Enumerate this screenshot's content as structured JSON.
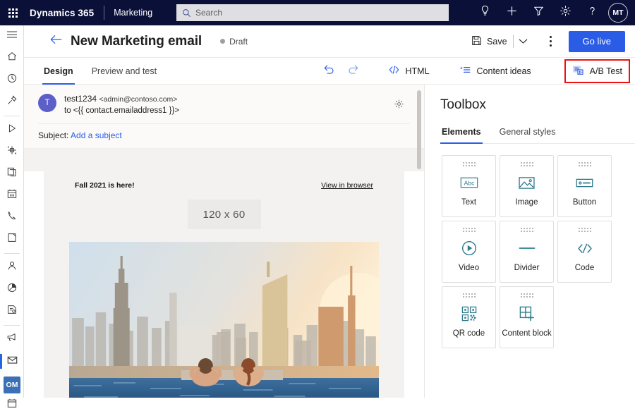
{
  "topnav": {
    "waffle_label": "App launcher",
    "brand": "Dynamics 365",
    "app_name": "Marketing",
    "search_placeholder": "Search",
    "search_value": "",
    "icons": [
      "lightbulb-icon",
      "plus-icon",
      "filter-icon",
      "gear-icon",
      "help-icon"
    ],
    "avatar_initials": "MT",
    "bg_color": "#0b1039"
  },
  "rail": {
    "items": [
      {
        "name": "hamburger-menu",
        "label": "Show more"
      },
      {
        "name": "home",
        "label": "Home"
      },
      {
        "name": "recent",
        "label": "Recent"
      },
      {
        "name": "pinned",
        "label": "Pinned"
      },
      {
        "name": "customer-journeys",
        "label": "Customer journeys"
      },
      {
        "name": "segments",
        "label": "Segments"
      },
      {
        "name": "marketing-pages",
        "label": "Marketing pages"
      },
      {
        "name": "events",
        "label": "Events"
      },
      {
        "name": "voice-calls",
        "label": "Voice calls"
      },
      {
        "name": "push-notifications",
        "label": "Push notifications"
      },
      {
        "name": "contacts",
        "label": "Contacts"
      },
      {
        "name": "insights",
        "label": "Insights"
      },
      {
        "name": "marketing-forms",
        "label": "Marketing forms"
      },
      {
        "name": "campaigns",
        "label": "Campaigns"
      },
      {
        "name": "marketing-emails",
        "label": "Marketing emails"
      },
      {
        "name": "social-posts",
        "label": "Social posts"
      },
      {
        "name": "calendar",
        "label": "Calendar"
      }
    ],
    "selected_index": 14,
    "badge": "OM",
    "badge_color": "#3b6fb6"
  },
  "commandbar": {
    "back_label": "Back",
    "title": "New Marketing email",
    "status": "Draft",
    "save_label": "Save",
    "save_chevron": "⌄",
    "more_label": "More commands",
    "golive_label": "Go live",
    "golive_color": "#2b5ce6"
  },
  "toolbar": {
    "tabs": [
      {
        "label": "Design",
        "active": true
      },
      {
        "label": "Preview and test",
        "active": false
      }
    ],
    "undo_label": "Undo",
    "redo_label": "Redo",
    "html_label": "HTML",
    "content_ideas_label": "Content ideas",
    "ab_test_label": "A/B Test",
    "ab_test_highlighted": true,
    "highlight_color": "#ee1111"
  },
  "email": {
    "avatar_initial": "T",
    "from_name": "test1234",
    "from_address": "<admin@contoso.com>",
    "to_line": "to <{{ contact.emailaddress1 }}>",
    "settings_label": "Email settings",
    "subject_label": "Subject:",
    "subject_placeholder": "Add a subject",
    "preheader": "Fall 2021 is here!",
    "view_in_browser": "View in browser",
    "logo_placeholder": "120 x 60",
    "hero_alt": "Couple in rooftop infinity pool overlooking New York City skyline"
  },
  "toolbox": {
    "title": "Toolbox",
    "tabs": [
      {
        "label": "Elements",
        "active": true
      },
      {
        "label": "General styles",
        "active": false
      }
    ],
    "elements": [
      {
        "label": "Text",
        "icon": "text-abc-icon"
      },
      {
        "label": "Image",
        "icon": "image-icon"
      },
      {
        "label": "Button",
        "icon": "button-icon"
      },
      {
        "label": "Video",
        "icon": "video-play-icon"
      },
      {
        "label": "Divider",
        "icon": "divider-icon"
      },
      {
        "label": "Code",
        "icon": "code-icon"
      },
      {
        "label": "QR code",
        "icon": "qr-code-icon"
      },
      {
        "label": "Content block",
        "icon": "content-block-icon"
      }
    ],
    "icon_color": "#2e7b8c"
  }
}
